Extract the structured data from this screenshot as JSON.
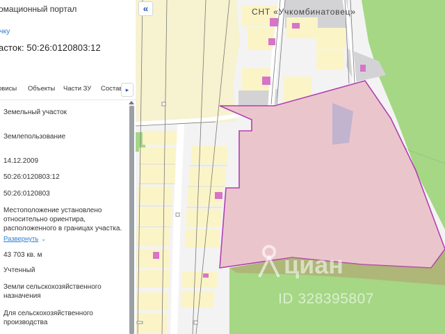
{
  "panel": {
    "portal_title": "омационный портал",
    "back_link": "чку",
    "parcel_title": "асток: 50:26:0120803:12",
    "tabs": [
      {
        "label": "рвисы"
      },
      {
        "label": "Объекты"
      },
      {
        "label": "Части ЗУ"
      },
      {
        "label": "Состав"
      }
    ],
    "tab_next_icon": "chevron-right-icon",
    "rows": [
      {
        "text": "Земельный участок"
      },
      {
        "text": "Землепользование"
      },
      {
        "text": "14.12.2009"
      },
      {
        "text": "50:26:0120803:12"
      },
      {
        "text": "50:26:0120803"
      },
      {
        "lines": [
          "Местоположение установлено",
          "относительно ориентира,",
          "расположенного в границах участка."
        ]
      },
      {
        "text": "43 703 кв. м"
      },
      {
        "text": "Учтенный"
      },
      {
        "lines": [
          "Земли сельскохозяйственного",
          "назначения"
        ]
      },
      {
        "lines": [
          "Для сельскохозяйственного",
          "производства"
        ]
      }
    ],
    "expand_label": "Развернуть",
    "expand_icon": "chevron-down-icon"
  },
  "map": {
    "collapse_icon": "double-chevron-left-icon",
    "collapse_symbol": "«",
    "settlement_label": "СНТ «Учкомбинатовец»",
    "watermark_brand": "циан",
    "watermark_id": "ID 328395807",
    "colors": {
      "parcel_fill": "#e9c3c9",
      "parcel_stroke": "#b13fb0",
      "forest": "#a5d785",
      "lots": "#fbf4c6",
      "lot_stroke": "#ded49a",
      "buildings": "#d874c8",
      "roads": "#ffffff",
      "field": "#f7f2cf",
      "grey_zone": "#d3d3d6"
    }
  }
}
